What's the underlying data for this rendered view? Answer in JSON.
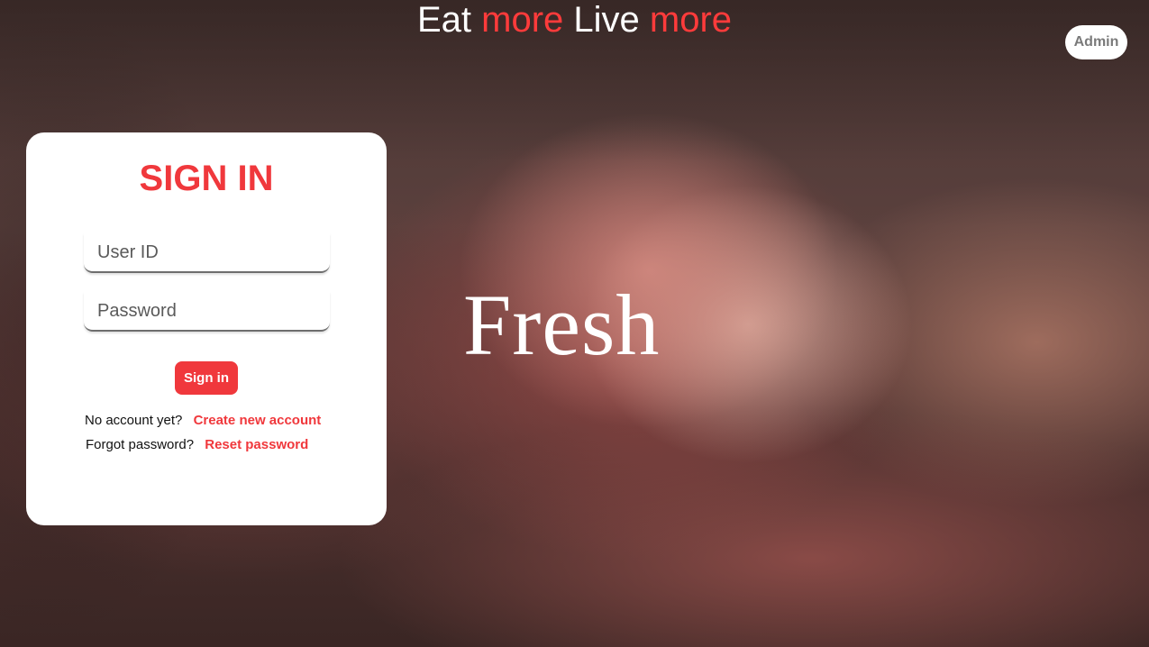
{
  "header": {
    "word1": "Eat",
    "word2": "more",
    "word3": "Live",
    "word4": "more"
  },
  "admin_button": "Admin",
  "hero_text": "Fresh",
  "login": {
    "title": "SIGN IN",
    "user_id_placeholder": "User ID",
    "password_placeholder": "Password",
    "signin_label": "Sign in",
    "no_account_text": "No account yet?",
    "create_account_link": "Create new account",
    "forgot_text": "Forgot password?",
    "reset_link": "Reset password"
  },
  "colors": {
    "accent": "#f0383c",
    "card_background": "#ffffff",
    "admin_text": "#7a7a7a"
  }
}
